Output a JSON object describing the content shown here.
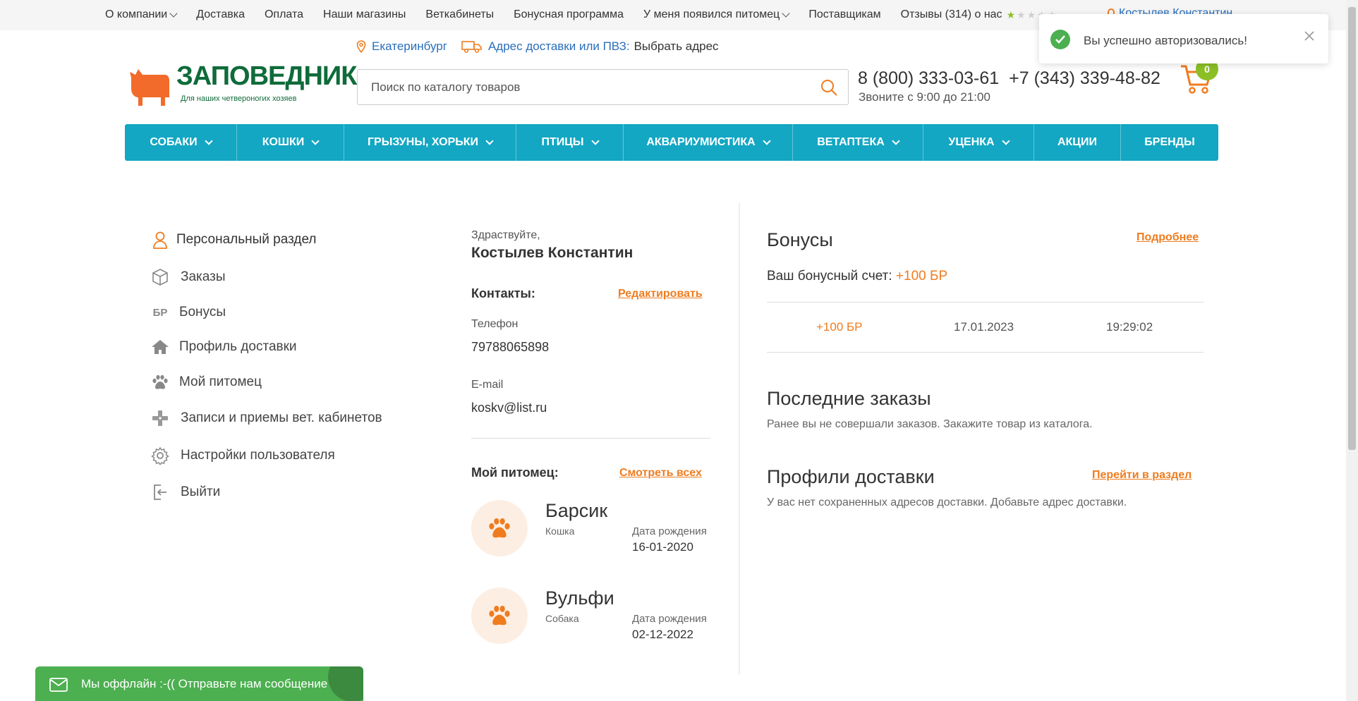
{
  "topnav": {
    "items": [
      "О компании",
      "Доставка",
      "Оплата",
      "Наши магазины",
      "Веткабинеты",
      "Бонусная программа",
      "У меня появился питомец",
      "Поставщикам",
      "Отзывы (314) о нас"
    ],
    "user": "Костылев Константин",
    "rating_filled": 1
  },
  "location": {
    "city": "Екатеринбург",
    "delivery_label": "Адрес доставки или ПВЗ:",
    "delivery_action": "Выбрать адрес"
  },
  "logo": {
    "title": "ЗАПОВЕДНИК",
    "subtitle": "Для наших четвероногих хозяев"
  },
  "search": {
    "placeholder": "Поиск по каталогу товаров",
    "value": ""
  },
  "contacts_header": {
    "phone1": "8 (800) 333-03-61",
    "phone2": "+7 (343) 339-48-82",
    "hours": "Звоните с 9:00 до 21:00"
  },
  "cart": {
    "count": "0"
  },
  "menu": {
    "items": [
      {
        "label": "СОБАКИ",
        "has_dropdown": true
      },
      {
        "label": "КОШКИ",
        "has_dropdown": true
      },
      {
        "label": "ГРЫЗУНЫ, ХОРЬКИ",
        "has_dropdown": true
      },
      {
        "label": "ПТИЦЫ",
        "has_dropdown": true
      },
      {
        "label": "АКВАРИУМИСТИКА",
        "has_dropdown": true
      },
      {
        "label": "ВЕТАПТЕКА",
        "has_dropdown": true
      },
      {
        "label": "УЦЕНКА",
        "has_dropdown": true
      },
      {
        "label": "АКЦИИ",
        "has_dropdown": false
      },
      {
        "label": "БРЕНДЫ",
        "has_dropdown": false
      }
    ]
  },
  "sidebar": {
    "items": [
      {
        "label": "Персональный раздел",
        "icon": "person-icon"
      },
      {
        "label": "Заказы",
        "icon": "box-icon"
      },
      {
        "label": "Бонусы",
        "icon": "bonus-icon"
      },
      {
        "label": "Профиль доставки",
        "icon": "home-icon"
      },
      {
        "label": "Мой питомец",
        "icon": "paw-icon"
      },
      {
        "label": "Записи и приемы вет. кабинетов",
        "icon": "vet-icon"
      },
      {
        "label": "Настройки пользователя",
        "icon": "gear-icon"
      },
      {
        "label": "Выйти",
        "icon": "logout-icon"
      }
    ]
  },
  "profile": {
    "greeting": "Здраствуйте,",
    "name": "Костылев Константин",
    "contacts_title": "Контакты:",
    "edit_label": "Редактировать",
    "phone_label": "Телефон",
    "phone": "79788065898",
    "email_label": "E-mail",
    "email": "koskv@list.ru",
    "pets_title": "Мой питомец:",
    "see_all_label": "Смотреть всех",
    "pets": [
      {
        "name": "Барсик",
        "type": "Кошка",
        "birth_label": "Дата рождения",
        "birth": "16-01-2020"
      },
      {
        "name": "Вульфи",
        "type": "Собака",
        "birth_label": "Дата рождения",
        "birth": "02-12-2022"
      }
    ]
  },
  "bonuses": {
    "title": "Бонусы",
    "more_label": "Подробнее",
    "account_label": "Ваш бонусный счет:",
    "account_value": "+100 БР",
    "history": [
      {
        "amount": "+100 БР",
        "date": "17.01.2023",
        "time": "19:29:02"
      }
    ]
  },
  "orders": {
    "title": "Последние заказы",
    "text": "Ранее вы не совершали заказов. Закажите товар из каталога."
  },
  "delivery_profiles": {
    "title": "Профили доставки",
    "link_label": "Перейти в раздел",
    "text": "У вас нет сохраненных адресов доставки. Добавьте адрес доставки."
  },
  "toast": {
    "message": "Вы успешно авторизовались!"
  },
  "chat": {
    "text": "Мы оффлайн :-(( Отправьте нам сообщение"
  },
  "colors": {
    "accent": "#ef7c1f",
    "menu": "#13a7c3",
    "brand_green": "#0f6b3a",
    "success": "#4caf50"
  }
}
